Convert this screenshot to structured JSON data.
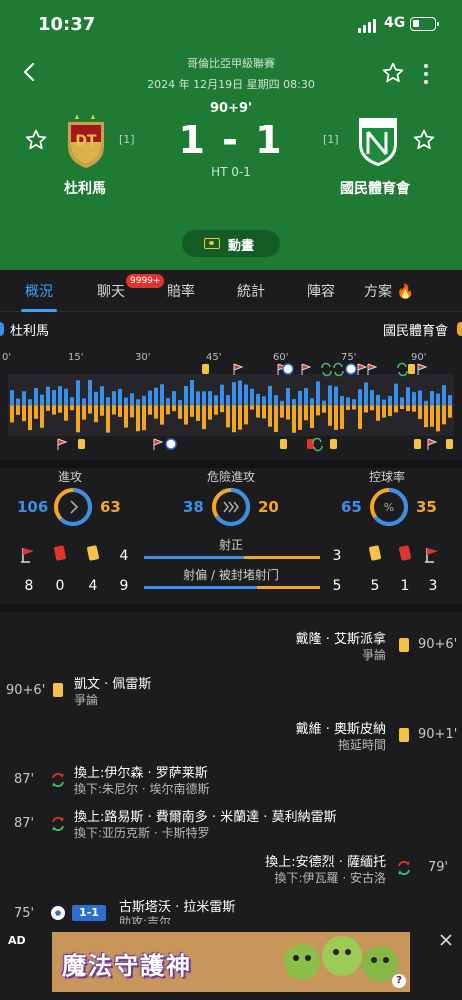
{
  "status_bar": {
    "time": "10:37",
    "network": "4G"
  },
  "header": {
    "league": "哥倫比亞甲級聯賽",
    "datetime": "2024 年 12月19日 星期四 08:30",
    "minute": "90+9'",
    "score": "1 - 1",
    "halftime": "HT 0-1",
    "home": {
      "name": "杜利馬",
      "rank": "[1]"
    },
    "away": {
      "name": "國民體育會",
      "rank": "[1]"
    },
    "animation_label": "動畫"
  },
  "tabs": [
    {
      "label": "概況",
      "active": true
    },
    {
      "label": "聊天",
      "badge": "9999+"
    },
    {
      "label": "賠率"
    },
    {
      "label": "統計"
    },
    {
      "label": "陣容"
    },
    {
      "label": "方案"
    }
  ],
  "timeline": {
    "home": "杜利馬",
    "away": "國民體育會",
    "ticks": [
      "0'",
      "15'",
      "30'",
      "45'",
      "60'",
      "75'",
      "90'"
    ],
    "colors": {
      "home": "#3a8fe8",
      "away": "#f5a623"
    }
  },
  "stats": {
    "attacks": {
      "label": "進攻",
      "home": "106",
      "away": "63",
      "home_share": 0.627
    },
    "dangerous": {
      "label": "危險進攻",
      "home": "38",
      "away": "20",
      "home_share": 0.655
    },
    "possession": {
      "label": "控球率",
      "home": "65",
      "away": "35",
      "home_share": 0.65
    },
    "home_counts": {
      "corners": "8",
      "red": "0",
      "yellow": "4"
    },
    "away_counts": {
      "yellow": "5",
      "red": "1",
      "corners": "3"
    },
    "shots_on": {
      "label": "射正",
      "home": "4",
      "away": "3",
      "home_share": 0.571
    },
    "shots_off": {
      "label": "射偏 / 被封堵射门",
      "home": "9",
      "away": "5",
      "home_share": 0.643
    }
  },
  "events": [
    {
      "side": "away",
      "type": "yellow",
      "minute": "90+6'",
      "player": "戴隆 · 艾斯派拿",
      "detail": "爭論"
    },
    {
      "side": "home",
      "type": "yellow",
      "minute": "90+6'",
      "player": "凱文 · 佩雷斯",
      "detail": "爭論"
    },
    {
      "side": "away",
      "type": "yellow",
      "minute": "90+1'",
      "player": "戴維 · 奧斯皮納",
      "detail": "拖延時間"
    },
    {
      "side": "home",
      "type": "sub",
      "minute": "87'",
      "player": "換上:伊尔森 · 罗萨莱斯",
      "detail": "換下:朱尼尔 · 埃尔南德斯"
    },
    {
      "side": "home",
      "type": "sub",
      "minute": "87'",
      "player": "換上:路易斯 · 費爾南多 · 米蘭達 · 莫利納雷斯",
      "detail": "換下:亚历克斯 · 卡斯特罗"
    },
    {
      "side": "away",
      "type": "sub",
      "minute": "79'",
      "player": "換上:安德烈 · 薩緬托",
      "detail": "換下:伊瓦羅 · 安古洛"
    },
    {
      "side": "home",
      "type": "goal",
      "minute": "75'",
      "score": "1-1",
      "player": "古斯塔沃 · 拉米雷斯",
      "detail": "助攻:吉尔"
    }
  ],
  "ad": {
    "label": "AD",
    "title": "魔法守護神"
  }
}
